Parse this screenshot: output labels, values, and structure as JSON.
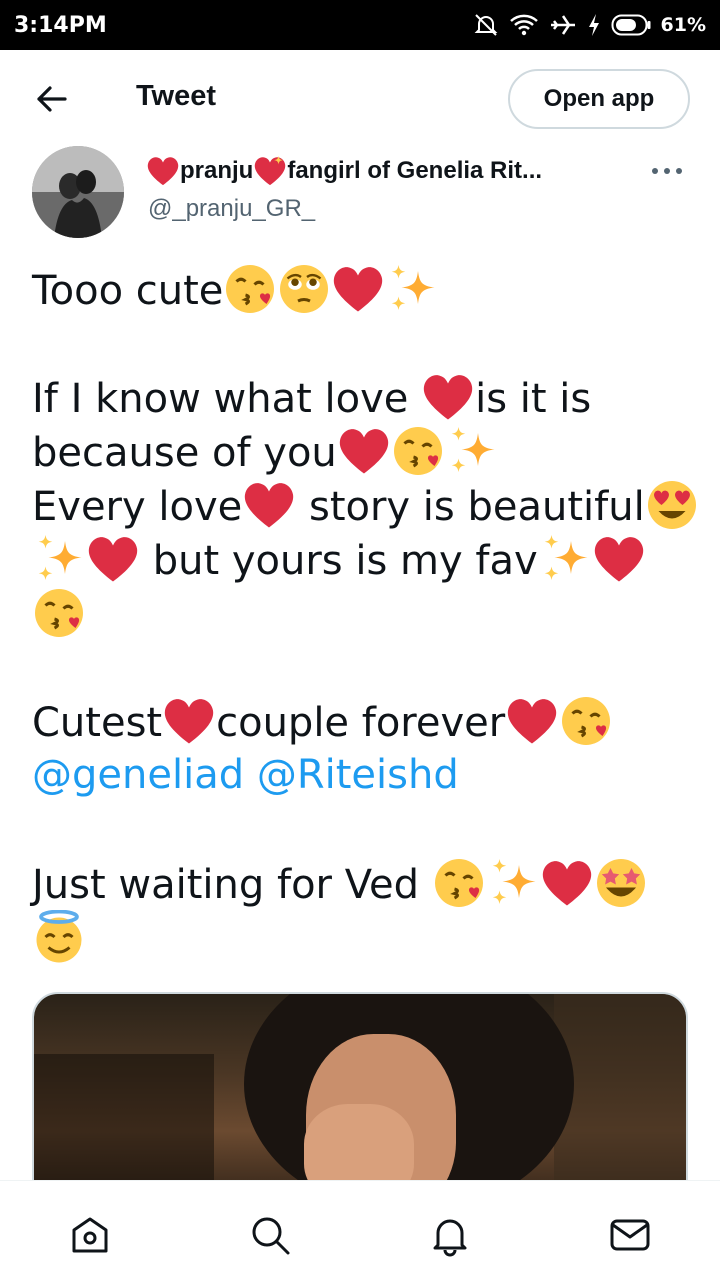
{
  "status_bar": {
    "time": "3:14PM",
    "battery": "61%",
    "icons": [
      "mute-icon",
      "wifi-icon",
      "airplane-icon",
      "charging-icon",
      "battery-icon"
    ]
  },
  "header": {
    "title": "Tweet",
    "open_app_label": "Open app",
    "back_icon": "arrow-left-icon"
  },
  "author": {
    "name_part1": "pranju",
    "name_part2": "fangirl of Genelia Rit...",
    "handle": "@_pranju_GR_",
    "more_icon": "more-horizontal-icon"
  },
  "tweet": {
    "line1": "Tooo cute",
    "line2a": "If I know what love ",
    "line2b": "is it is",
    "line3": "because of you",
    "line4a": "Every love",
    "line4b": " story is beautiful",
    "line5": " but yours is my fav",
    "line6a": "Cutest",
    "line6b": "couple forever",
    "mention1": "@geneliad",
    "mention2": "@Riteishd",
    "line8": "Just waiting for Ved "
  },
  "bottom_nav": {
    "items": [
      "home-icon",
      "search-icon",
      "notifications-icon",
      "messages-icon"
    ]
  },
  "colors": {
    "accent": "#1d9bf0",
    "text": "#0f1419",
    "secondary": "#536471",
    "heart": "#dd2e44"
  }
}
